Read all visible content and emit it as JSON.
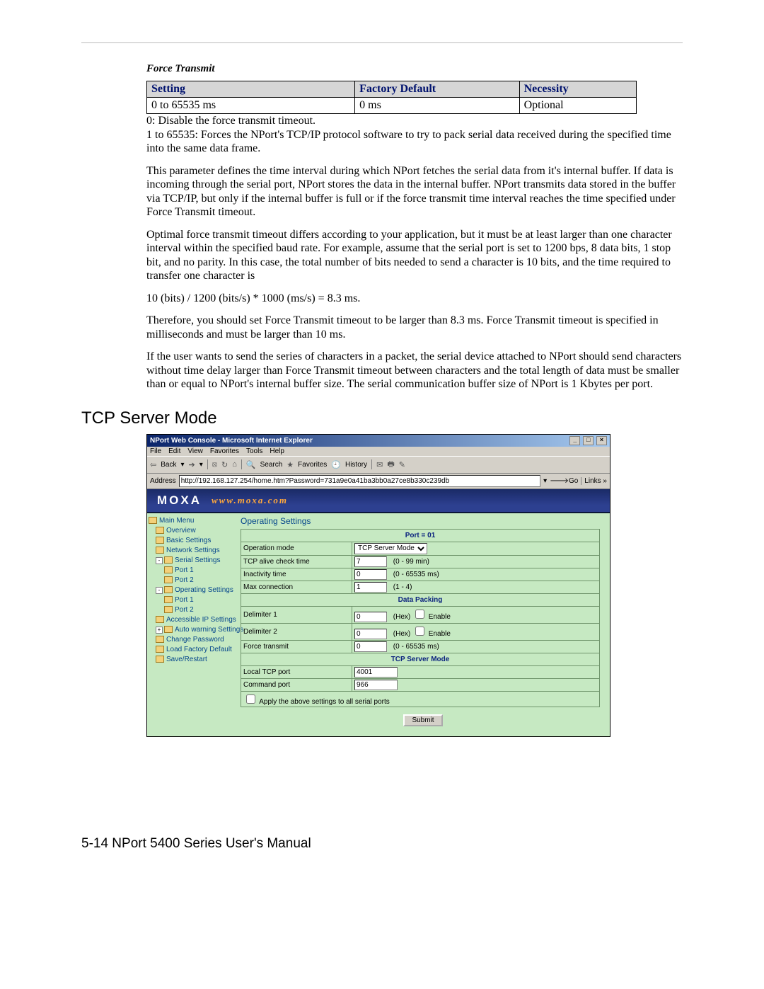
{
  "param_title": "Force Transmit",
  "table": {
    "headers": [
      "Setting",
      "Factory Default",
      "Necessity"
    ],
    "row": [
      "0 to 65535 ms",
      "0 ms",
      "Optional"
    ]
  },
  "paras": {
    "p1": "0: Disable the force transmit timeout.",
    "p2": "1 to 65535: Forces the NPort's TCP/IP protocol software to try to pack serial data received during the specified time into the same data frame.",
    "p3": "This parameter defines the time interval during which NPort fetches the serial data from it's internal buffer. If data is incoming through the serial port, NPort stores the data in the internal buffer. NPort transmits data stored in the buffer via TCP/IP, but only if the internal buffer is full or if the force transmit time interval reaches the time specified under Force Transmit timeout.",
    "p4": "Optimal force transmit timeout differs according to your application, but it must be at least larger than one character interval within the specified baud rate. For example, assume that the serial port is set to 1200 bps, 8 data bits, 1 stop bit, and no parity. In this case, the total number of bits needed to send a character is 10 bits, and the time required to transfer one character is",
    "p5": "10 (bits) / 1200 (bits/s) * 1000 (ms/s) = 8.3 ms.",
    "p6": "Therefore, you should set Force Transmit timeout to be larger than 8.3 ms. Force Transmit timeout is specified in milliseconds and must be larger than 10 ms.",
    "p7": "If the user wants to send the series of characters in a packet, the serial device attached to NPort should send characters without time delay larger than Force Transmit timeout between characters and the total length of data must be smaller than or equal to NPort's internal buffer size. The serial communication buffer size of NPort is 1 Kbytes per port."
  },
  "section_heading": "TCP Server Mode",
  "ie": {
    "title": "NPort Web Console - Microsoft Internet Explorer",
    "menus": [
      "File",
      "Edit",
      "View",
      "Favorites",
      "Tools",
      "Help"
    ],
    "tb_back": "Back",
    "tb_search": "Search",
    "tb_fav": "Favorites",
    "tb_hist": "History",
    "addr_label": "Address",
    "addr_value": "http://192.168.127.254/home.htm?Password=731a9e0a41ba3bb0a27ce8b330c239db",
    "go_label": "Go",
    "links_label": "Links"
  },
  "banner": {
    "brand": "MOXA",
    "url": "www.moxa.com"
  },
  "tree": {
    "root": "Main Menu",
    "items": [
      {
        "cls": "ind1",
        "txt": "Overview"
      },
      {
        "cls": "ind1",
        "txt": "Basic Settings"
      },
      {
        "cls": "ind1",
        "txt": "Network Settings"
      },
      {
        "cls": "ind1",
        "pm": "-",
        "txt": "Serial Settings"
      },
      {
        "cls": "ind2",
        "txt": "Port 1"
      },
      {
        "cls": "ind2",
        "txt": "Port 2"
      },
      {
        "cls": "ind1",
        "pm": "-",
        "txt": "Operating Settings"
      },
      {
        "cls": "ind2",
        "txt": "Port 1"
      },
      {
        "cls": "ind2",
        "txt": "Port 2"
      },
      {
        "cls": "ind1",
        "txt": "Accessible IP Settings"
      },
      {
        "cls": "ind1",
        "pm": "+",
        "txt": "Auto warning Settings"
      },
      {
        "cls": "ind1",
        "txt": "Change Password"
      },
      {
        "cls": "ind1",
        "txt": "Load Factory Default"
      },
      {
        "cls": "ind1",
        "txt": "Save/Restart"
      }
    ]
  },
  "form": {
    "heading": "Operating Settings",
    "sec_port": "Port = 01",
    "op_mode_label": "Operation mode",
    "op_mode_value": "TCP Server Mode",
    "alive_label": "TCP alive check time",
    "alive_value": "7",
    "alive_hint": "(0 - 99 min)",
    "inact_label": "Inactivity time",
    "inact_value": "0",
    "inact_hint": "(0 - 65535 ms)",
    "maxc_label": "Max connection",
    "maxc_value": "1",
    "maxc_hint": "(1 - 4)",
    "sec_pack": "Data Packing",
    "d1_label": "Delimiter 1",
    "d1_value": "0",
    "d2_label": "Delimiter 2",
    "d2_value": "0",
    "hex_hint": "(Hex)",
    "enable_label": "Enable",
    "ft_label": "Force transmit",
    "ft_value": "0",
    "ft_hint": "(0 - 65535 ms)",
    "sec_tcp": "TCP Server Mode",
    "ltcp_label": "Local TCP port",
    "ltcp_value": "4001",
    "cmd_label": "Command port",
    "cmd_value": "966",
    "apply_label": "Apply the above settings to all serial ports",
    "submit": "Submit"
  },
  "footer": "5-14  NPort 5400 Series User's Manual"
}
